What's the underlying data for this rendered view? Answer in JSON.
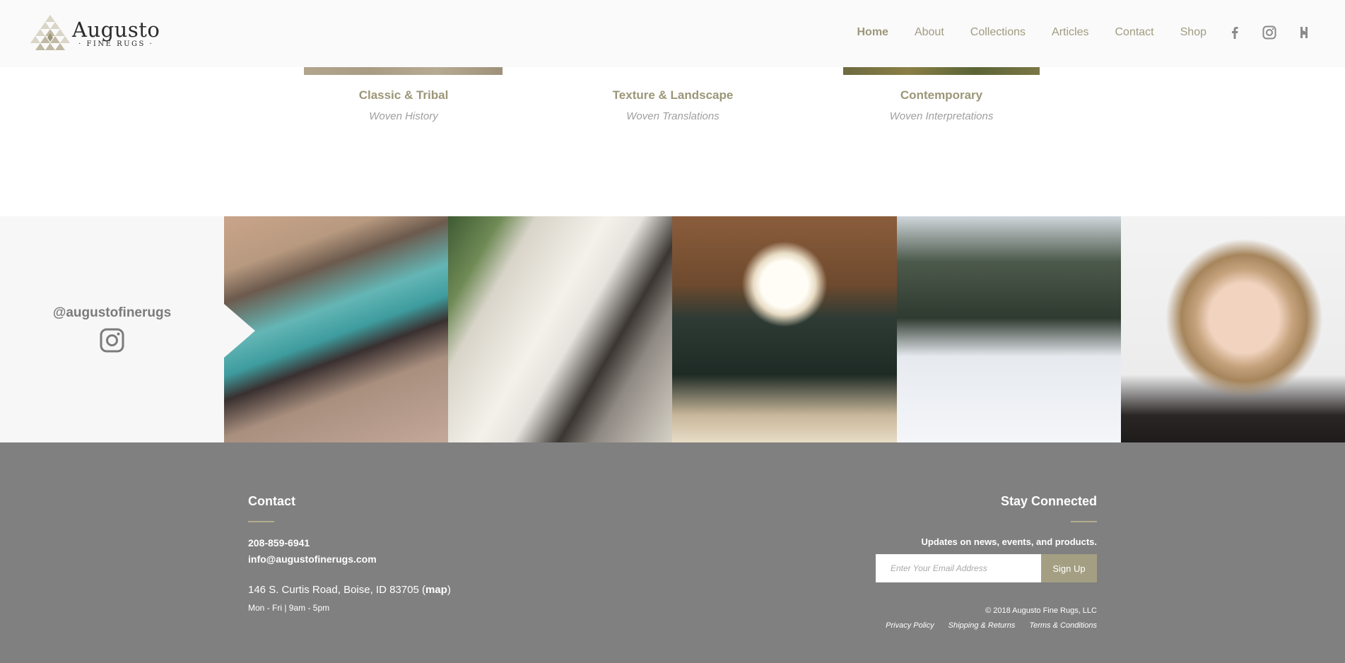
{
  "header": {
    "logo": {
      "name": "Augusto",
      "sub": "· FINE RUGS ·"
    },
    "nav": [
      {
        "label": "Home"
      },
      {
        "label": "About"
      },
      {
        "label": "Collections"
      },
      {
        "label": "Articles"
      },
      {
        "label": "Contact"
      },
      {
        "label": "Shop"
      }
    ],
    "social_icons": [
      "facebook-icon",
      "instagram-icon",
      "houzz-icon"
    ]
  },
  "collections": [
    {
      "title": "Classic & Tribal",
      "subtitle": "Woven History"
    },
    {
      "title": "Texture & Landscape",
      "subtitle": "Woven Translations"
    },
    {
      "title": "Contemporary",
      "subtitle": "Woven Interpretations"
    }
  ],
  "instagram": {
    "handle": "@augustofinerugs",
    "icon": "instagram-icon"
  },
  "footer": {
    "contact": {
      "title": "Contact",
      "phone": "208-859-6941",
      "email": "info@augustofinerugs.com",
      "address_text": "146 S. Curtis Road, Boise, ID 83705 (",
      "map_label": "map",
      "address_close": ")",
      "hours": "Mon - Fri | 9am - 5pm"
    },
    "stay": {
      "title": "Stay Connected",
      "updates": "Updates on news, events, and products.",
      "email_placeholder": "Enter Your Email Address",
      "signup_label": "Sign Up",
      "copyright": "© 2018 Augusto Fine Rugs, LLC",
      "links": [
        "Privacy Policy",
        "Shipping & Returns",
        "Terms & Conditions"
      ]
    }
  },
  "colors": {
    "accent": "#9b9678",
    "footer_bg": "#808080",
    "button_bg": "#a49f82"
  }
}
